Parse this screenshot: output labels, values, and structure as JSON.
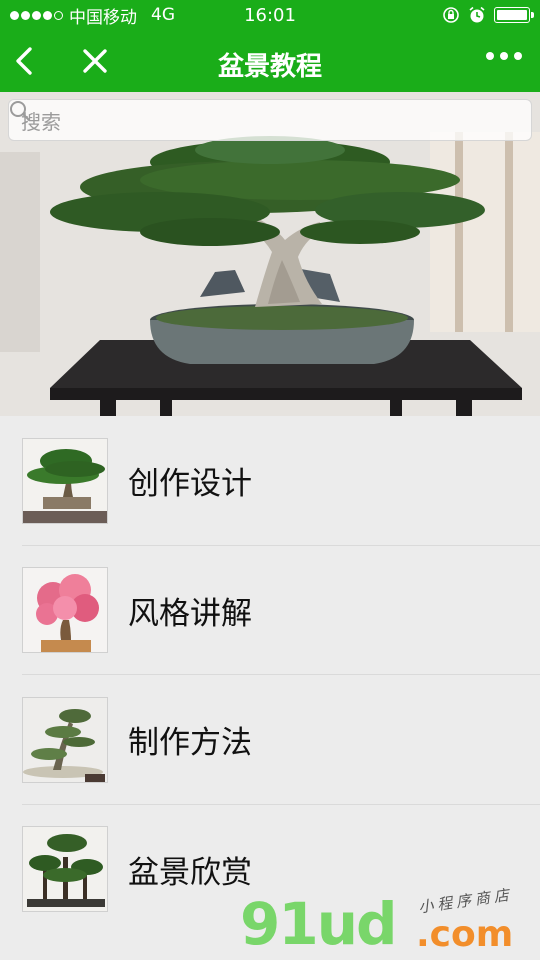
{
  "status_bar": {
    "carrier": "中国移动",
    "network": "4G",
    "time": "16:01"
  },
  "nav": {
    "title": "盆景教程"
  },
  "search": {
    "placeholder": "搜索"
  },
  "banner": {
    "slides": 4,
    "active_index": 1
  },
  "menu": [
    {
      "label": "创作设计",
      "icon": "bonsai-pine-thumbnail"
    },
    {
      "label": "风格讲解",
      "icon": "bonsai-pink-flowers-thumbnail"
    },
    {
      "label": "制作方法",
      "icon": "bonsai-cascade-thumbnail"
    },
    {
      "label": "盆景欣赏",
      "icon": "bonsai-forest-thumbnail"
    }
  ],
  "watermark": {
    "brand": "91ud",
    "domain": ".com",
    "tagline": "小程序商店"
  },
  "colors": {
    "accent": "#1aad19",
    "watermark_green": "#79d66a",
    "watermark_orange": "#f28e2b"
  }
}
